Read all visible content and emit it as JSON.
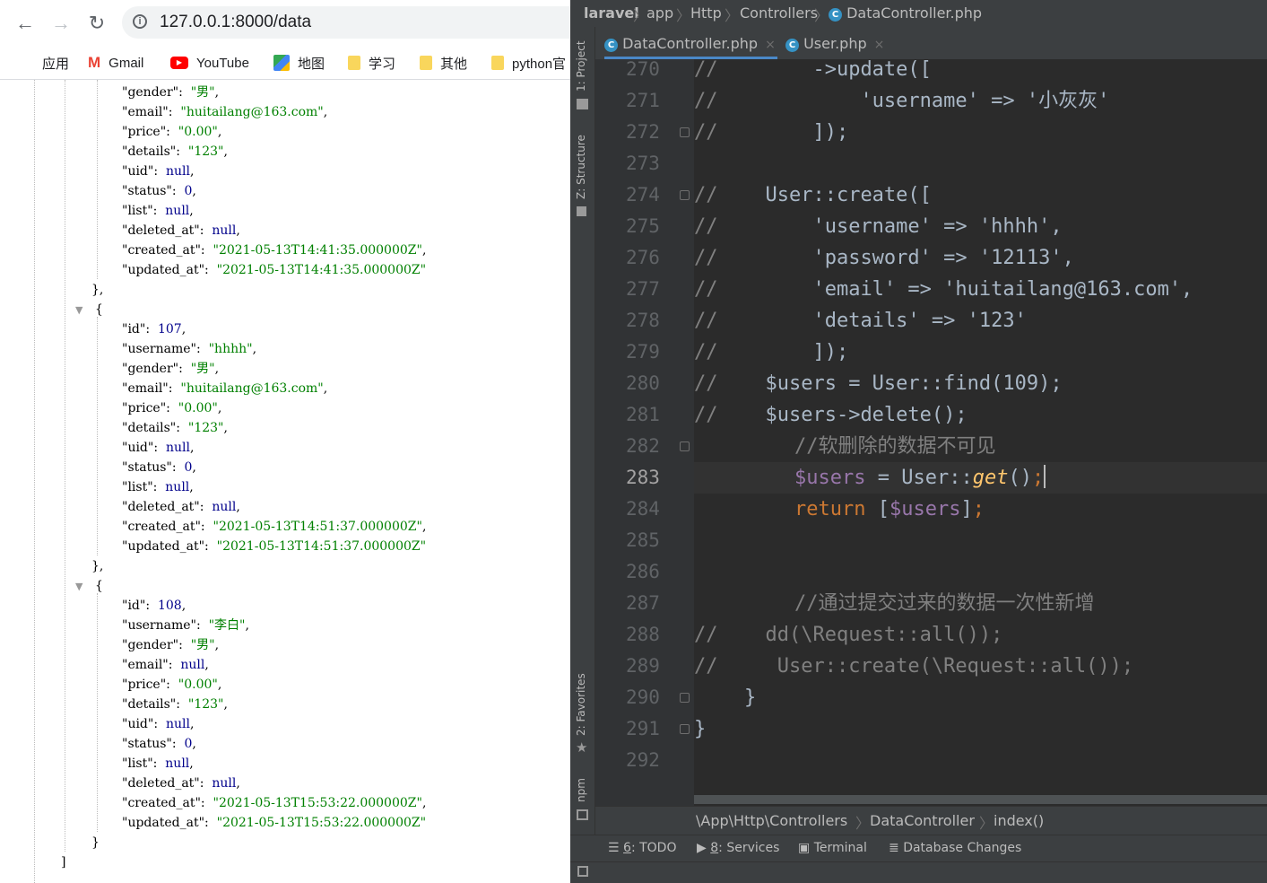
{
  "browser": {
    "nav": {
      "back": "←",
      "forward": "→",
      "reload": "↻"
    },
    "url": "127.0.0.1:8000/data",
    "bookmarks": [
      "应用",
      "Gmail",
      "YouTube",
      "地图",
      "学习",
      "其他",
      "python官"
    ]
  },
  "json_view": {
    "record1_tail": {
      "gender_key": "\"gender\":",
      "gender": "\"男\"",
      "email_key": "\"email\":",
      "email": "\"huitailang@163.com\"",
      "price_key": "\"price\":",
      "price": "\"0.00\"",
      "details_key": "\"details\":",
      "details": "\"123\"",
      "uid_key": "\"uid\":",
      "uid": "null",
      "status_key": "\"status\":",
      "status": "0",
      "list_key": "\"list\":",
      "list": "null",
      "deleted_key": "\"deleted_at\":",
      "deleted": "null",
      "created_key": "\"created_at\":",
      "created": "\"2021-05-13T14:41:35.000000Z\"",
      "updated_key": "\"updated_at\":",
      "updated": "\"2021-05-13T14:41:35.000000Z\""
    },
    "record2": {
      "id_key": "\"id\":",
      "id": "107",
      "username_key": "\"username\":",
      "username": "\"hhhh\"",
      "gender_key": "\"gender\":",
      "gender": "\"男\"",
      "email_key": "\"email\":",
      "email": "\"huitailang@163.com\"",
      "price_key": "\"price\":",
      "price": "\"0.00\"",
      "details_key": "\"details\":",
      "details": "\"123\"",
      "uid_key": "\"uid\":",
      "uid": "null",
      "status_key": "\"status\":",
      "status": "0",
      "list_key": "\"list\":",
      "list": "null",
      "deleted_key": "\"deleted_at\":",
      "deleted": "null",
      "created_key": "\"created_at\":",
      "created": "\"2021-05-13T14:51:37.000000Z\"",
      "updated_key": "\"updated_at\":",
      "updated": "\"2021-05-13T14:51:37.000000Z\""
    },
    "record3": {
      "id_key": "\"id\":",
      "id": "108",
      "username_key": "\"username\":",
      "username": "\"李白\"",
      "gender_key": "\"gender\":",
      "gender": "\"男\"",
      "email_key": "\"email\":",
      "email": "null",
      "price_key": "\"price\":",
      "price": "\"0.00\"",
      "details_key": "\"details\":",
      "details": "\"123\"",
      "uid_key": "\"uid\":",
      "uid": "null",
      "status_key": "\"status\":",
      "status": "0",
      "list_key": "\"list\":",
      "list": "null",
      "deleted_key": "\"deleted_at\":",
      "deleted": "null",
      "created_key": "\"created_at\":",
      "created": "\"2021-05-13T15:53:22.000000Z\"",
      "updated_key": "\"updated_at\":",
      "updated": "\"2021-05-13T15:53:22.000000Z\""
    },
    "punct": {
      "obj_close_comma": "},",
      "obj_open": "{",
      "obj_close": "}",
      "arr_close": "]",
      "comma": ","
    }
  },
  "ide": {
    "breadcrumbs": [
      "laravel",
      "app",
      "Http",
      "Controllers",
      "DataController.php"
    ],
    "tabs": [
      {
        "label": "DataController.php",
        "close": "×"
      },
      {
        "label": "User.php",
        "close": "×"
      }
    ],
    "side_tools": {
      "project": "1: Project",
      "structure": "Z: Structure",
      "favorites": "2: Favorites",
      "npm": "npm"
    },
    "line_numbers": [
      "270",
      "271",
      "272",
      "273",
      "274",
      "275",
      "276",
      "277",
      "278",
      "279",
      "280",
      "281",
      "282",
      "283",
      "284",
      "285",
      "286",
      "287",
      "288",
      "289",
      "290",
      "291",
      "292"
    ],
    "code": {
      "l270": {
        "c": "//",
        "t": "        ->update(["
      },
      "l271": {
        "c": "//",
        "t": "            'username' => '小灰灰'"
      },
      "l272": {
        "c": "//",
        "t": "        ]);"
      },
      "l274": {
        "c": "//",
        "t": "    User::create(["
      },
      "l275": {
        "c": "//",
        "t": "        'username' => 'hhhh',"
      },
      "l276": {
        "c": "//",
        "t": "        'password' => '12113',"
      },
      "l277": {
        "c": "//",
        "t": "        'email' => 'huitailang@163.com',"
      },
      "l278": {
        "c": "//",
        "t": "        'details' => '123'"
      },
      "l279": {
        "c": "//",
        "t": "        ]);"
      },
      "l280": {
        "c": "//",
        "t": "    $users = User::find(109);"
      },
      "l281": {
        "c": "//",
        "t": "    $users->delete();"
      },
      "l282": {
        "t": "//软删除的数据不可见"
      },
      "l283": {
        "var": "$users",
        "op": " = User::",
        "fn": "get",
        "paren": "()",
        "semi": ";"
      },
      "l284": {
        "kw": "return",
        "b1": " [",
        "var": "$users",
        "b2": "]",
        "semi": ";"
      },
      "l287": {
        "t": "//通过提交过来的数据一次性新增"
      },
      "l288": {
        "c": "//",
        "t": "    dd(\\Request::all());"
      },
      "l289": {
        "c": "//",
        "t": "     User::create(\\Request::all());"
      },
      "l290": {
        "t": "}"
      },
      "l291": {
        "t": "}"
      }
    },
    "path_bar": [
      "\\App\\Http\\Controllers",
      "DataController",
      "index()"
    ],
    "tool_windows": [
      {
        "num": "6",
        "label": ": TODO"
      },
      {
        "num": "8",
        "label": ": Services"
      },
      {
        "num": "",
        "label": "Terminal"
      },
      {
        "num": "",
        "label": "Database Changes"
      }
    ],
    "colors": {
      "keyword": "#cc7832",
      "variable": "#9876aa",
      "function": "#ffc66d",
      "comment": "#808080",
      "text": "#a9b7c6"
    }
  }
}
